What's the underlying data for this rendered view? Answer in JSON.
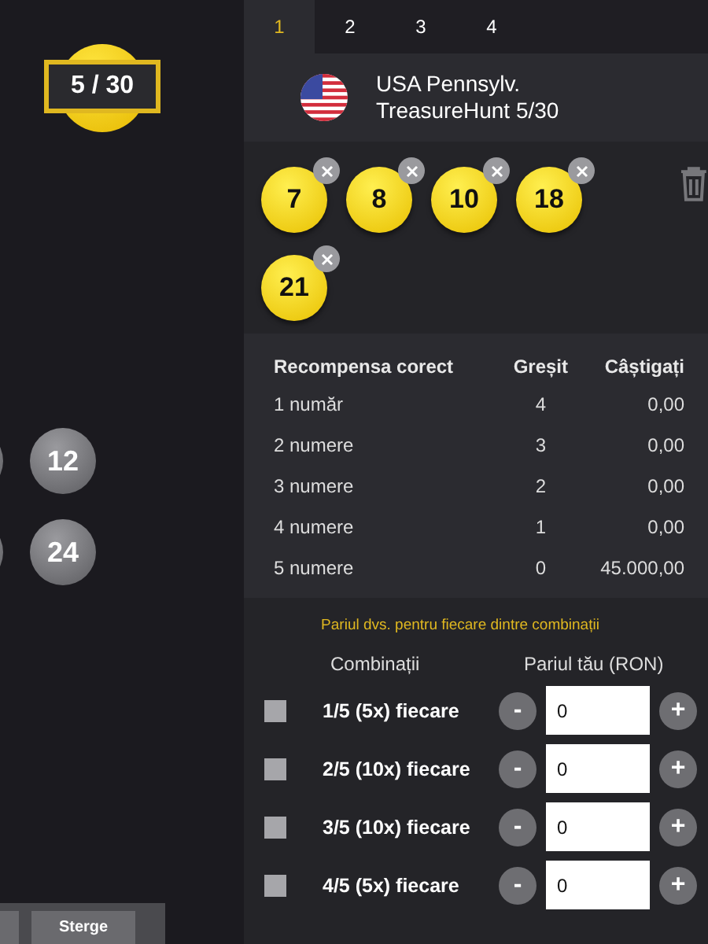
{
  "left_panel": {
    "counter": "5 / 30",
    "ball_rows": [
      {
        "ball": "12"
      },
      {
        "ball": "24"
      }
    ],
    "buttons": [
      "Sterge"
    ]
  },
  "tabs": [
    {
      "label": "1",
      "selected": true
    },
    {
      "label": "2",
      "selected": false
    },
    {
      "label": "3",
      "selected": false
    },
    {
      "label": "4",
      "selected": false
    }
  ],
  "game": {
    "name": "USA Pennsylv. TreasureHunt 5/30"
  },
  "selected_numbers": [
    "7",
    "8",
    "10",
    "18",
    "21"
  ],
  "prize_table": {
    "columns": [
      "Recompensa corect",
      "Greșit",
      "Câștigați"
    ],
    "rows": [
      [
        "1 număr",
        "4",
        "0,00"
      ],
      [
        "2 numere",
        "3",
        "0,00"
      ],
      [
        "3 numere",
        "2",
        "0,00"
      ],
      [
        "4 numere",
        "1",
        "0,00"
      ],
      [
        "5 numere",
        "0",
        "45.000,00"
      ]
    ]
  },
  "bets": {
    "note": "Pariul dvs. pentru fiecare dintre combinații",
    "columns": [
      "Combinații",
      "Pariul tău (RON)"
    ],
    "rows": [
      {
        "label": "1/5 (5x) fiecare",
        "checked": false,
        "value": "0",
        "minus": "-",
        "plus": "+"
      },
      {
        "label": "2/5 (10x) fiecare",
        "checked": false,
        "value": "0",
        "minus": "-",
        "plus": "+"
      },
      {
        "label": "3/5 (10x) fiecare",
        "checked": false,
        "value": "0",
        "minus": "-",
        "plus": "+"
      },
      {
        "label": "4/5 (5x) fiecare",
        "checked": false,
        "value": "0",
        "minus": "-",
        "plus": "+"
      }
    ]
  }
}
